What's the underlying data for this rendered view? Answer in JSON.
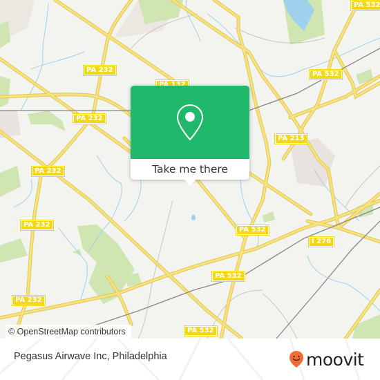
{
  "map": {
    "attribution": "© OpenStreetMap contributors",
    "colors": {
      "land": "#f3f3ef",
      "road": "#f7e27c",
      "road_casing": "#e6cd5a",
      "water": "#9fd1ec",
      "park": "#cfe5b2",
      "residential": "#e8e2dc",
      "rail": "#888888",
      "shield": "#f2d818"
    },
    "route_shields": [
      {
        "label": "PA 532",
        "id": "pa532-top-right"
      },
      {
        "label": "PA 232",
        "id": "pa232-top"
      },
      {
        "label": "PA 132",
        "id": "pa132"
      },
      {
        "label": "PA 532",
        "id": "pa532-upper-right"
      },
      {
        "label": "PA 232",
        "id": "pa232-mid"
      },
      {
        "label": "PA 213",
        "id": "pa213"
      },
      {
        "label": "PA 232",
        "id": "pa232-left-1"
      },
      {
        "label": "PA 232",
        "id": "pa232-left-2"
      },
      {
        "label": "PA 532",
        "id": "pa532-center"
      },
      {
        "label": "I 276",
        "id": "i276"
      },
      {
        "label": "PA 532",
        "id": "pa532-lower"
      },
      {
        "label": "PA 232",
        "id": "pa232-left-3"
      },
      {
        "label": "PA 532",
        "id": "pa532-bottom"
      }
    ]
  },
  "popup": {
    "icon": "location-pin-icon",
    "action_label": "Take me there",
    "color": "#20b96c"
  },
  "footer": {
    "place_name": "Pegasus Airwave Inc, Philadelphia",
    "brand": "moovit",
    "brand_color": "#f26a36"
  }
}
